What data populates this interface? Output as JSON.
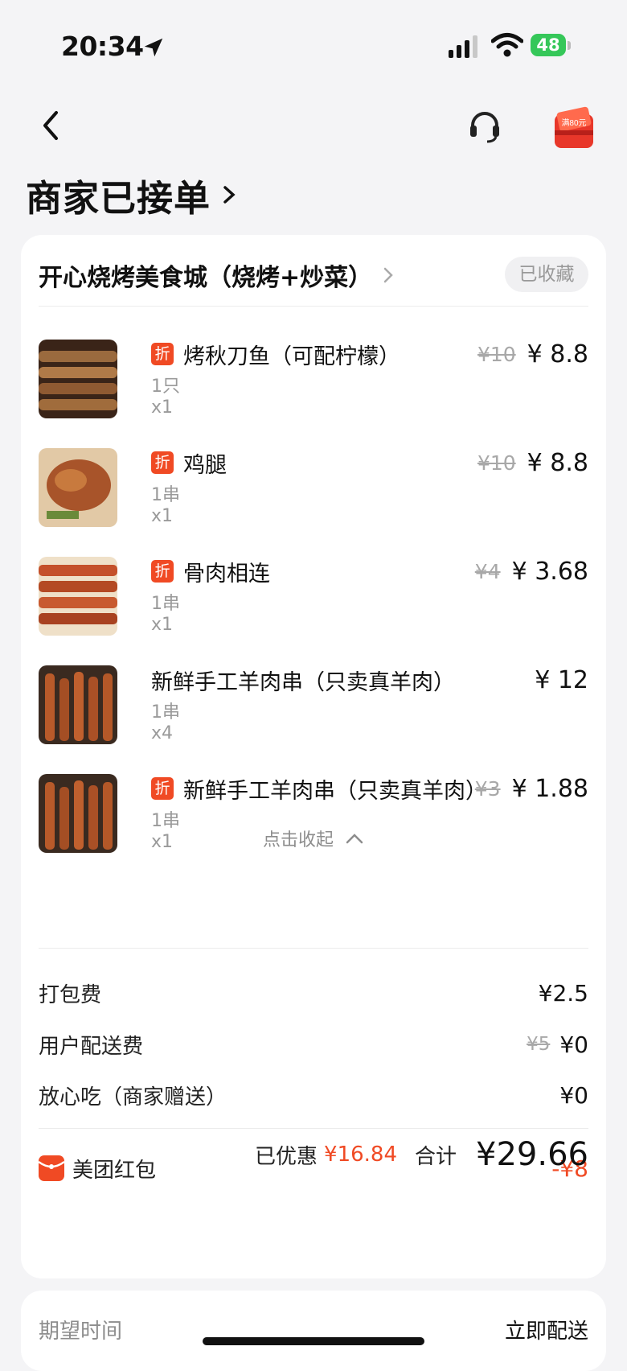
{
  "status_bar": {
    "time": "20:34",
    "battery": "48"
  },
  "header": {
    "title": "商家已接单",
    "coupon_badge_text": "满80元"
  },
  "shop": {
    "name": "开心烧烤美食城（烧烤+炒菜）",
    "favorite_label": "已收藏"
  },
  "items": [
    {
      "name": "烤秋刀鱼（可配柠檬）",
      "spec": "1只",
      "qty": "x1",
      "orig_price": "¥10",
      "price": "¥ 8.8",
      "discount_badge": "折",
      "image": "grilled-saury"
    },
    {
      "name": "鸡腿",
      "spec": "1串",
      "qty": "x1",
      "orig_price": "¥10",
      "price": "¥ 8.8",
      "discount_badge": "折",
      "image": "chicken-leg"
    },
    {
      "name": "骨肉相连",
      "spec": "1串",
      "qty": "x1",
      "orig_price": "¥4",
      "price": "¥ 3.68",
      "discount_badge": "折",
      "image": "meat-skewers"
    },
    {
      "name": "新鲜手工羊肉串（只卖真羊肉）",
      "spec": "1串",
      "qty": "x4",
      "orig_price": "",
      "price": "¥ 12",
      "discount_badge": "",
      "image": "lamb-skewers"
    },
    {
      "name": "新鲜手工羊肉串（只卖真羊肉）",
      "spec": "1串",
      "qty": "x1",
      "orig_price": "¥3",
      "price": "¥ 1.88",
      "discount_badge": "折",
      "image": "lamb-skewers"
    }
  ],
  "collapse_label": "点击收起",
  "fees": {
    "packing": {
      "label": "打包费",
      "value": "¥2.5"
    },
    "delivery": {
      "label": "用户配送费",
      "orig": "¥5",
      "value": "¥0"
    },
    "assurance": {
      "label": "放心吃（商家赠送）",
      "value": "¥0"
    },
    "red_packet": {
      "label": "美团红包",
      "value": "-¥8"
    }
  },
  "totals": {
    "saved_label": "已优惠",
    "saved_value": "¥16.84",
    "sum_label": "合计",
    "sum_value": "¥29.66"
  },
  "expected": {
    "label": "期望时间",
    "value": "立即配送"
  },
  "colors": {
    "accent": "#f04a24",
    "background": "#f4f4f6",
    "battery": "#35c759"
  }
}
